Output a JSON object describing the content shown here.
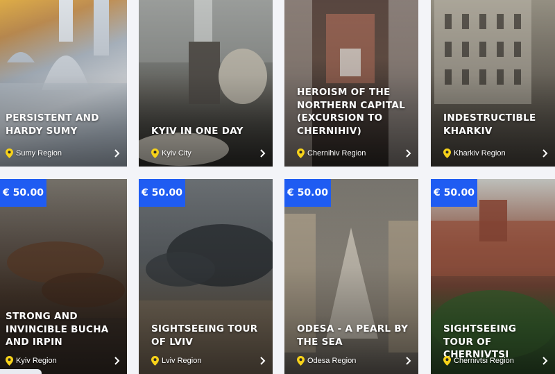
{
  "accent": "#1f5cf2",
  "icons": {
    "location": "location-pin-icon",
    "arrow": "chevron-right-icon"
  },
  "tours": [
    {
      "title": "Persistent and hardy Sumy",
      "region": "Sumy Region",
      "price": ""
    },
    {
      "title": "Kyiv in one day",
      "region": "Kyiv City",
      "price": ""
    },
    {
      "title": "Heroism of the Northern Capital (excursion to Chernihiv)",
      "region": "Chernihiv Region",
      "price": ""
    },
    {
      "title": "Indestructible Kharkiv",
      "region": "Kharkiv Region",
      "price": ""
    },
    {
      "title": "Strong and invincible Bucha and Irpin",
      "region": "Kyiv Region",
      "price": "€ 50.00"
    },
    {
      "title": "Sightseeing tour of Lviv",
      "region": "Lviv Region",
      "price": "€ 50.00"
    },
    {
      "title": "Odesa - a pearl by the sea",
      "region": "Odesa Region",
      "price": "€ 50.00"
    },
    {
      "title": "Sightseeing tour of Chernivtsi",
      "region": "Chernivtsi Region",
      "price": "€ 50.00"
    }
  ]
}
